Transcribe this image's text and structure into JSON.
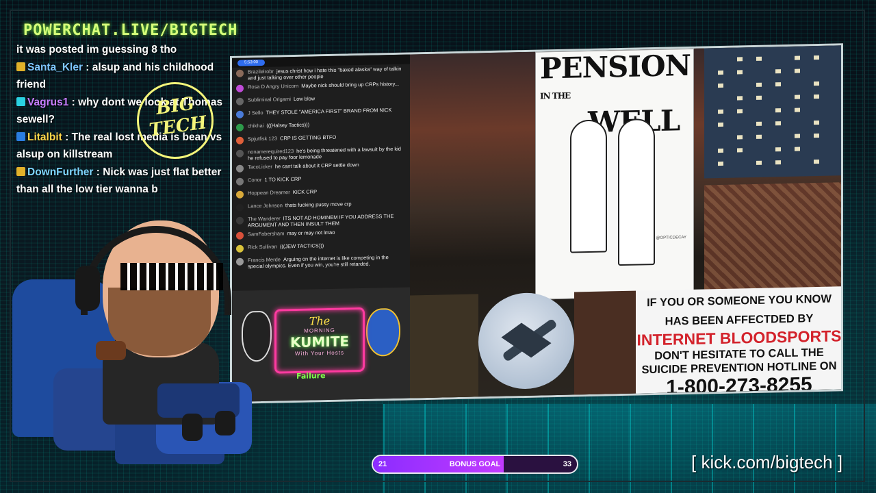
{
  "brand": "POWERCHAT.LIVE/BIGTECH",
  "logo": {
    "line1": "BIG",
    "line2": "TECH"
  },
  "chat": [
    {
      "user": "",
      "user_color": "#ffffff",
      "text": "it was posted im guessing 8 tho"
    },
    {
      "user": "Santa_Kler",
      "user_color": "#7fc6ff",
      "text": ": alsup and his childhood friend"
    },
    {
      "user": "Vagrus1",
      "user_color": "#c77dff",
      "text": ": why dont we look at Thomas sewell?"
    },
    {
      "user": "Litalbit",
      "user_color": "#ffd64a",
      "text": ": The real lost media is bean vs alsup on killstream"
    },
    {
      "user": "DownFurther",
      "user_color": "#7fd6ff",
      "text": ": Nick was just flat better than all the low tier wanna b"
    }
  ],
  "yt_chat": {
    "pill": "5:53:00",
    "rows": [
      {
        "name": "Brazilelrobr",
        "text": "jesus christ how i hate this \"baked alaska\" way of talkin and just talking over other people",
        "color": "#8a6a5a"
      },
      {
        "name": "Rosa D Angry Unicorn",
        "text": "Maybe nick should bring up CRPs history...",
        "color": "#c04bd8"
      },
      {
        "name": "Subliminal Origami",
        "text": "Low blow",
        "color": "#666"
      },
      {
        "name": "J Sello",
        "text": "THEY STOLE \"AMERICA FIRST\" BRAND FROM NICK",
        "color": "#4a7bd8"
      },
      {
        "name": "chikhai",
        "text": "(((Halsey Tactics)))",
        "color": "#2d9a4a"
      },
      {
        "name": "Spjutfisk 123",
        "text": "CRP IS GETTING BTFO",
        "color": "#e0603a"
      },
      {
        "name": "nonamerequired123",
        "text": "he's being threatened with a lawsuit by the kid he refused to pay foor lemonade",
        "color": "#555"
      },
      {
        "name": "TacoLicker",
        "text": "he cant talk about it CRP settle down",
        "color": "#888"
      },
      {
        "name": "Conor",
        "text": "1 TO KICK CRP",
        "color": "#777"
      },
      {
        "name": "Hoppean Dreamer",
        "text": "KICK CRP",
        "color": "#d8a93a"
      },
      {
        "name": "Lance Johnson",
        "text": "thats fucking pussy move crp",
        "color": "#222"
      },
      {
        "name": "The Wanderer",
        "text": "ITS NOT AD HOMINEM IF YOU ADDRESS THE ARGUMENT AND THEN INSULT THEM",
        "color": "#3a3a3a"
      },
      {
        "name": "SamFabersham",
        "text": "may or may not lmao",
        "color": "#d8503a"
      },
      {
        "name": "Rick Sullivan",
        "text": "(((JEW TACTICS)))",
        "color": "#d8c23a"
      },
      {
        "name": "Francis Merde",
        "text": "Arguing on the internet is like competing in the special olympics. Even if you win, you're still retarded.",
        "color": "#999"
      }
    ]
  },
  "kumite": {
    "the": "The",
    "small": "MORNING",
    "big": "KUMITE",
    "tagline": "With Your Hosts",
    "fail": "Failure"
  },
  "poster": {
    "title": "PENSION",
    "sub": "IN THE",
    "title2": "WELL",
    "credit": "@OPTICDECAY"
  },
  "hotline": {
    "line1": "IF YOU OR SOMEONE YOU KNOW",
    "line2": "HAS BEEN AFFECTDED BY",
    "line3": "INTERNET BLOODSPORTS",
    "line4": "DON'T HESITATE TO CALL THE",
    "line5": "SUICIDE PREVENTION HOTLINE ON",
    "line6": "1-800-273-8255"
  },
  "bonus": {
    "current": "21",
    "label": "BONUS GOAL",
    "target": "33",
    "progress_fraction": 0.64
  },
  "kick": "[ kick.com/bigtech ]",
  "colors": {
    "accent_green": "#d6ff7a",
    "bonus_purple": "#a636ff",
    "hotline_red": "#d3222b",
    "logo_yellow": "#f4f57a"
  }
}
